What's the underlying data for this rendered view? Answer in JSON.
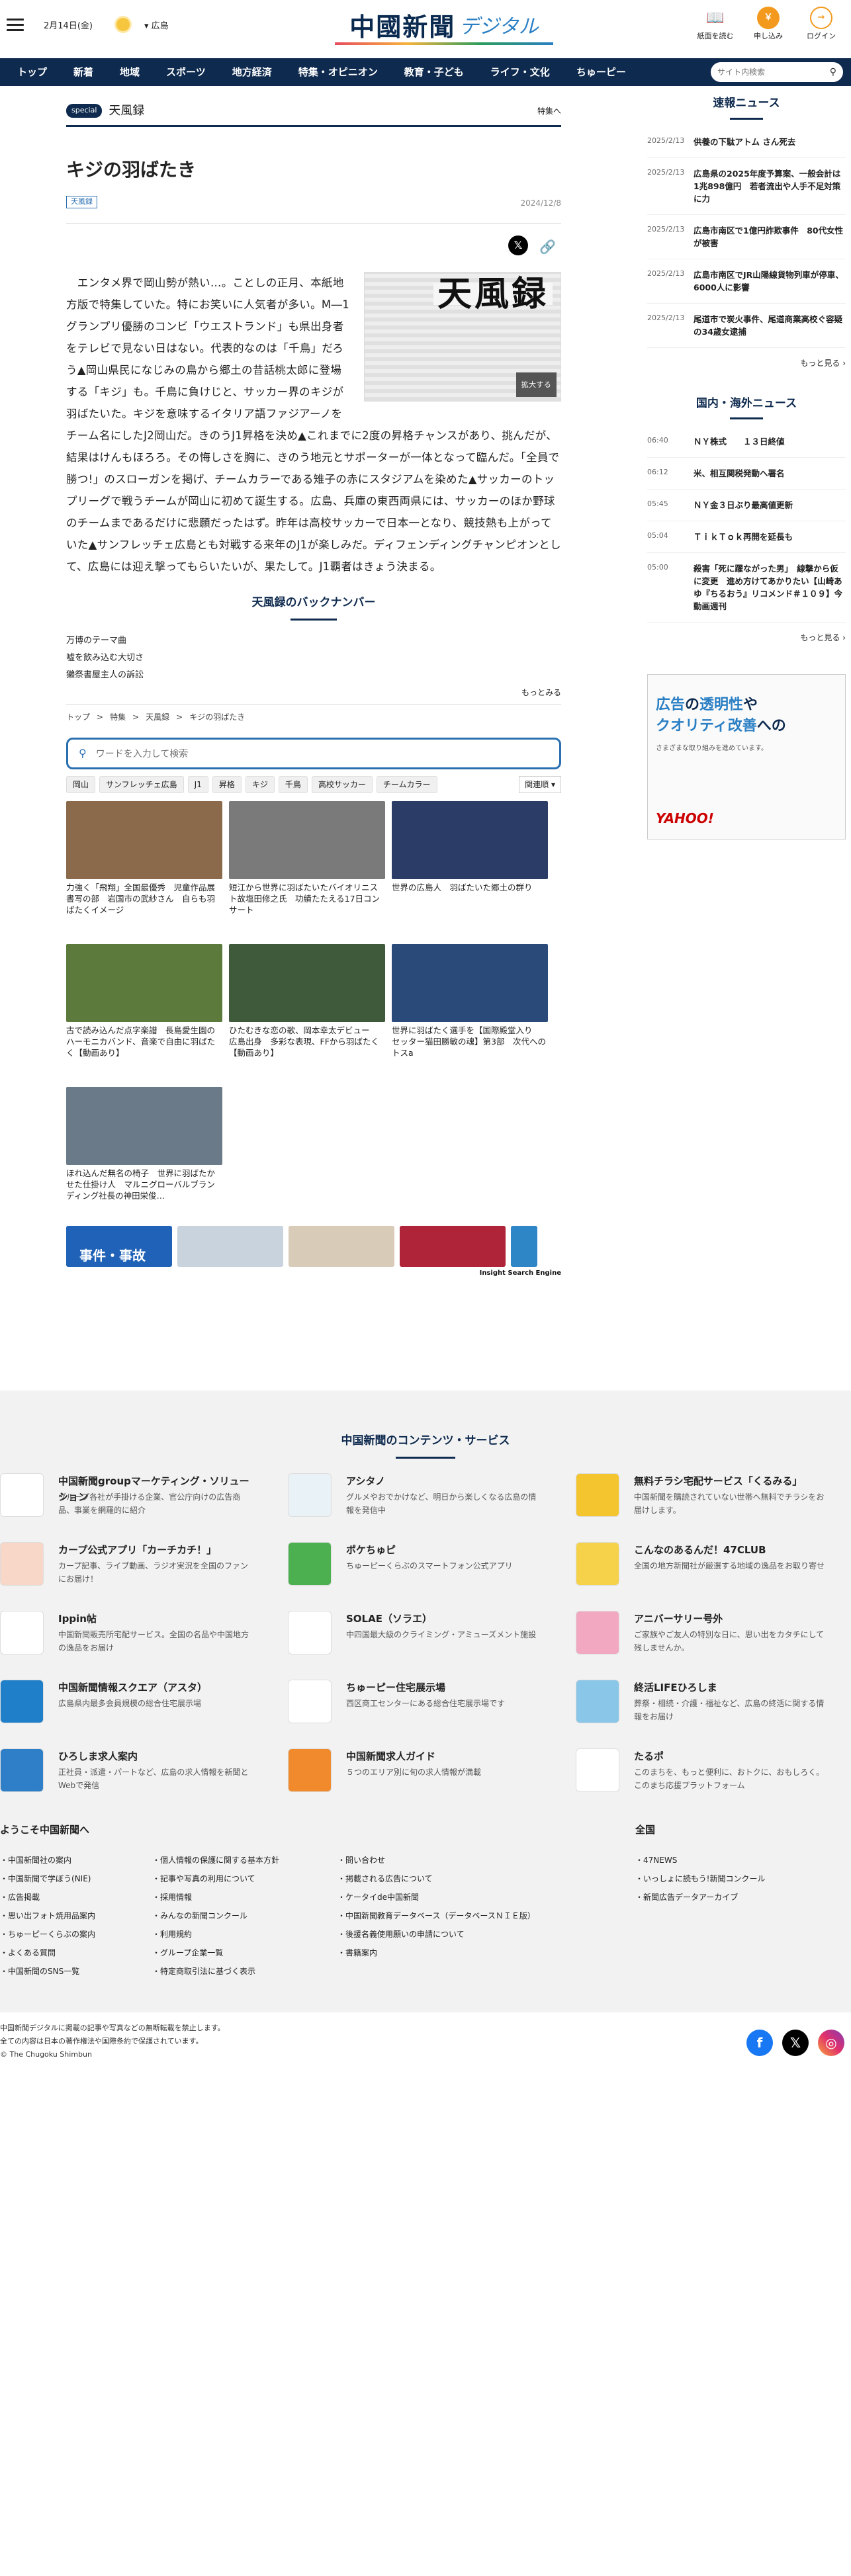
{
  "header": {
    "date": "2月14日(金)",
    "region": "広島",
    "logo_main": "中國新聞",
    "logo_sub": "デジタル",
    "btn_paper": "紙面を読む",
    "btn_join": "申し込み",
    "btn_login": "ログイン"
  },
  "nav": {
    "items": [
      "トップ",
      "新着",
      "地域",
      "スポーツ",
      "地方経済",
      "特集・オピニオン",
      "教育・子ども",
      "ライフ・文化",
      "ちゅーピー"
    ],
    "search_placeholder": "サイト内検索"
  },
  "article": {
    "badge": "special",
    "section": "天風録",
    "tokushu": "特集へ",
    "title": "キジの羽ばたき",
    "tag": "天風録",
    "date": "2024/12/8",
    "figure_title": "天風録",
    "zoom_label": "拡大する",
    "body": "　エンタメ界で岡山勢が熱い…。ことしの正月、本紙地方版で特集していた。特にお笑いに人気者が多い。M―1グランプリ優勝のコンビ「ウエストランド」も県出身者をテレビで見ない日はない。代表的なのは「千鳥」だろう▲岡山県民になじみの鳥から郷土の昔話桃太郎に登場する「キジ」も。千鳥に負けじと、サッカー界のキジが羽ばたいた。キジを意味するイタリア語ファジアーノをチーム名にしたJ2岡山だ。きのうJ1昇格を決め▲これまでに2度の昇格チャンスがあり、挑んだが、結果はけんもほろろ。その悔しさを胸に、きのう地元とサポーターが一体となって臨んだ。「全員で勝つ!」のスローガンを掲げ、チームカラーである雉子の赤にスタジアムを染めた▲サッカーのトップリーグで戦うチームが岡山に初めて誕生する。広島、兵庫の東西両県には、サッカーのほか野球のチームまであるだけに悲願だったはず。昨年は高校サッカーで日本一となり、競技熱も上がっていた▲サンフレッチェ広島とも対戦する来年のJ1が楽しみだ。ディフェンディングチャンピオンとして、広島には迎え撃ってもらいたいが、果たして。J1覇者はきょう決まる。"
  },
  "backnumber": {
    "heading": "天風録のバックナンバー",
    "items": [
      "万博のテーマ曲",
      "嘘を飲み込む大切さ",
      "獺祭書屋主人の訴訟"
    ],
    "more": "もっとみる"
  },
  "breadcrumb": [
    "トップ",
    "特集",
    "天風録",
    "キジの羽ばたき"
  ],
  "search": {
    "placeholder": "ワードを入力して検索",
    "chips": [
      "岡山",
      "サンフレッチェ広島",
      "J1",
      "昇格",
      "キジ",
      "千鳥",
      "高校サッカー",
      "チームカラー"
    ],
    "sort": "関連順"
  },
  "related": [
    {
      "caption": "力強く「飛翔」全国最優秀　児童作品展書写の部　岩国市の武紗さん　自らも羽ばたくイメージ",
      "color": "#8a6a4a"
    },
    {
      "caption": "短江から世界に羽ばたいたバイオリニスト故塩田修之氏　功績たたえる17日コンサート",
      "color": "#7a7a7a"
    },
    {
      "caption": "世界の広島人　羽ばたいた郷土の群り",
      "color": "#2b3d66"
    },
    {
      "caption": "古で読み込んだ点字楽譜　長島愛生園のハーモニカバンド、音楽で自由に羽ばたく【動画あり】",
      "color": "#5b7a3c"
    },
    {
      "caption": "ひたむきな恋の歌、岡本幸太デビュー　広島出身　多彩な表現、FFから羽ばたく【動画あり】",
      "color": "#3f5a3a"
    },
    {
      "caption": "世界に羽ばたく選手を【国際殿堂入り　セッター猫田勝敏の魂】第3部　次代へのトスa",
      "color": "#2a4a7a"
    },
    {
      "caption": "ほれ込んだ無名の椅子　世界に羽ばたかせた仕掛け人　マルニグローバルブランディング社長の神田栄俊…",
      "color": "#6a7a88"
    }
  ],
  "category_tiles": [
    {
      "label": "事件・事故",
      "color": "#1f62b8"
    },
    {
      "label": "",
      "color": "#c9d3de"
    },
    {
      "label": "",
      "color": "#d8ccb8"
    },
    {
      "label": "",
      "color": "#b0243a"
    },
    {
      "label": "",
      "color": "#2f86c7"
    }
  ],
  "ise_label": "Insight Search Engine",
  "sokuho": {
    "heading": "速報ニュース",
    "more": "もっと見る ›",
    "items": [
      {
        "time": "2025/2/13",
        "title": "供養の下駄アトム さん死去"
      },
      {
        "time": "2025/2/13",
        "title": "広島県の2025年度予算案、一般会計は1兆898億円　若者流出や人手不足対策に力"
      },
      {
        "time": "2025/2/13",
        "title": "広島市南区で1億円詐欺事件　80代女性が被害"
      },
      {
        "time": "2025/2/13",
        "title": "広島市南区でJR山陽線貨物列車が停車、6000人に影響"
      },
      {
        "time": "2025/2/13",
        "title": "尾道市で炭火事件、尾道商業高校ぐ容疑の34歳女逮捕"
      }
    ]
  },
  "world": {
    "heading": "国内・海外ニュース",
    "more": "もっと見る ›",
    "items": [
      {
        "time": "06:40",
        "title": "ＮＹ株式　　１３日終値"
      },
      {
        "time": "06:12",
        "title": "米、相互関税発動へ署名"
      },
      {
        "time": "05:45",
        "title": "ＮＹ金３日ぶり最高値更新"
      },
      {
        "time": "05:04",
        "title": "ＴｉｋＴｏｋ再開を延長も"
      },
      {
        "time": "05:00",
        "title": "殺害「死に躍ながった男」　線撃から仮に変更　進め方けてあかりたい【山崎あゆ『ちるおう』リコメンド＃１０９】今動画週刊"
      }
    ]
  },
  "ad": {
    "line1": "広告",
    "line1b": "の",
    "line2": "透明性",
    "line2b": "や",
    "line3": "クオリティ",
    "line3b": "改善",
    "line3c": "への",
    "sub": "さまざまな取り組みを進めています。",
    "brand": "YAHOO!"
  },
  "footer": {
    "heading": "中国新聞のコンテンツ・サービス",
    "services": [
      {
        "title": "中国新聞groupマーケティング・ソリューション",
        "desc": "グループ各社が手掛ける企業、官公庁向けの広告商品、事業を網羅的に紹介",
        "color": "#ffffff"
      },
      {
        "title": "アシタノ",
        "desc": "グルメやおでかけなど、明日から楽しくなる広島の情報を発信中",
        "color": "#e9f3f7"
      },
      {
        "title": "無料チラシ宅配サービス「くるみる」",
        "desc": "中国新聞を購読されていない世帯へ無料でチラシをお届けします。",
        "color": "#f4c52e"
      },
      {
        "title": "カープ公式アプリ「カーチカチ！」",
        "desc": "カープ記事、ライブ動画、ラジオ実況を全国のファンにお届け！",
        "color": "#f8d6c8"
      },
      {
        "title": "ポケちゅピ",
        "desc": "ちゅーピーくらぶのスマートフォン公式アプリ",
        "color": "#4caf50"
      },
      {
        "title": "こんなのあるんだ！47CLUB",
        "desc": "全国の地方新聞社が厳選する地域の逸品をお取り寄せ",
        "color": "#f6d24a"
      },
      {
        "title": "Ippin帖",
        "desc": "中国新聞販売所宅配サービス。全国の名品や中国地方の逸品をお届け",
        "color": "#ffffff"
      },
      {
        "title": "SOLAE（ソラエ）",
        "desc": "中四国最大級のクライミング・アミューズメント施設",
        "color": "#ffffff"
      },
      {
        "title": "アニバーサリー号外",
        "desc": "ご家族やご友人の特別な日に、思い出をカタチにして残しませんか。",
        "color": "#f2a8c0"
      },
      {
        "title": "中国新聞情報スクエア（アスタ）",
        "desc": "広島県内最多会員規模の総合住宅展示場",
        "color": "#1f7fc8"
      },
      {
        "title": "ちゅーピー住宅展示場",
        "desc": "西区商工センターにある総合住宅展示場です",
        "color": "#ffffff"
      },
      {
        "title": "終活LIFEひろしま",
        "desc": "葬祭・相続・介護・福祉など、広島の終活に関する情報をお届け",
        "color": "#8ac6e8"
      },
      {
        "title": "ひろしま求人案内",
        "desc": "正社員・派遣・パートなど、広島の求人情報を新聞とWebで発信",
        "color": "#2e7fc7"
      },
      {
        "title": "中国新聞求人ガイド",
        "desc": "５つのエリア別に旬の求人情報が満載",
        "color": "#f08a2c"
      },
      {
        "title": "たるポ",
        "desc": "このまちを、もっと便利に、おトクに、おもしろく。このまち応援プラットフォーム",
        "color": "#ffffff"
      }
    ],
    "welcome_head": "ようこそ中国新聞へ",
    "col1": [
      "中国新聞社の案内",
      "中国新聞で学ぼう(NIE)",
      "広告掲載",
      "思い出フォト焼用品案内",
      "ちゅーピーくらぶの案内",
      "よくある質問",
      "中国新聞のSNS一覧"
    ],
    "col2": [
      "個人情報の保護に関する基本方針",
      "記事や写真の利用について",
      "採用情報",
      "みんなの新聞コンクール",
      "利用規約",
      "グループ企業一覧",
      "特定商取引法に基づく表示"
    ],
    "col3": [
      "問い合わせ",
      "掲載される広告について",
      "ケータイde中国新聞",
      "中国新聞教育データベース（データベースＮＩＥ版）",
      "後援名義使用願いの申請について",
      "書籍案内"
    ],
    "zenkoku_head": "全国",
    "col4": [
      "47NEWS",
      "いっしょに読もう!新聞コンクール",
      "新聞広告データアーカイブ"
    ],
    "copyright": [
      "中国新聞デジタルに掲載の記事や写真などの無断転載を禁止します。",
      "全ての内容は日本の著作権法や国際条約で保護されています。",
      "© The Chugoku Shimbun"
    ]
  }
}
